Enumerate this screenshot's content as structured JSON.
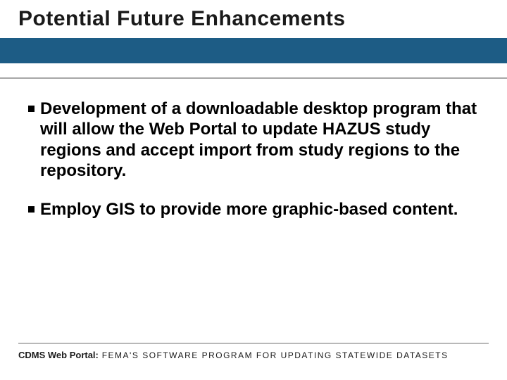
{
  "title": "Potential Future Enhancements",
  "bullets": [
    "Development of a downloadable desktop program that will allow the Web Portal to update HAZUS study regions and accept import from study regions to the repository.",
    "Employ GIS to provide more graphic-based content."
  ],
  "footer": {
    "strong": "CDMS Web Portal:",
    "rest": " FEMA'S  SOFTWARE  PROGRAM  FOR  UPDATING  STATEWIDE  DATASETS"
  },
  "colors": {
    "bar": "#1d5c85"
  }
}
